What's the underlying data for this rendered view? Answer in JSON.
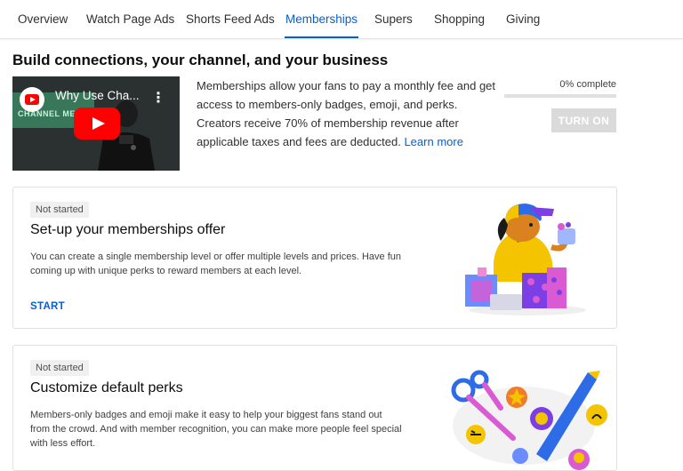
{
  "tabs": [
    {
      "label": "Overview"
    },
    {
      "label": "Watch Page Ads"
    },
    {
      "label": "Shorts Feed Ads"
    },
    {
      "label": "Memberships"
    },
    {
      "label": "Supers"
    },
    {
      "label": "Shopping"
    },
    {
      "label": "Giving"
    }
  ],
  "active_tab": "Memberships",
  "page_title": "Build connections, your channel, and your business",
  "video": {
    "title": "Why Use Cha...",
    "background_text": "CHANNEL MEMBERSHIPS"
  },
  "description": {
    "text": "Memberships allow your fans to pay a monthly fee and get access to members-only badges, emoji, and perks. Creators receive 70% of membership revenue after applicable taxes and fees are deducted. ",
    "link": "Learn more"
  },
  "progress": {
    "label": "0% complete",
    "fraction": 0
  },
  "turn_on_button": "TURN ON",
  "cards": [
    {
      "badge": "Not started",
      "title": "Set-up your memberships offer",
      "body": "You can create a single membership level or offer multiple levels and prices. Have fun coming up with unique perks to reward members at each level.",
      "action": "START"
    },
    {
      "badge": "Not started",
      "title": "Customize default perks",
      "body": "Members-only badges and emoji make it easy to help your biggest fans stand out from the crowd. And with member recognition, you can make more people feel special with less effort."
    }
  ],
  "colors": {
    "accent": "#065fd4",
    "youtube_red": "#ff0000",
    "disabled_button": "#dadada"
  }
}
